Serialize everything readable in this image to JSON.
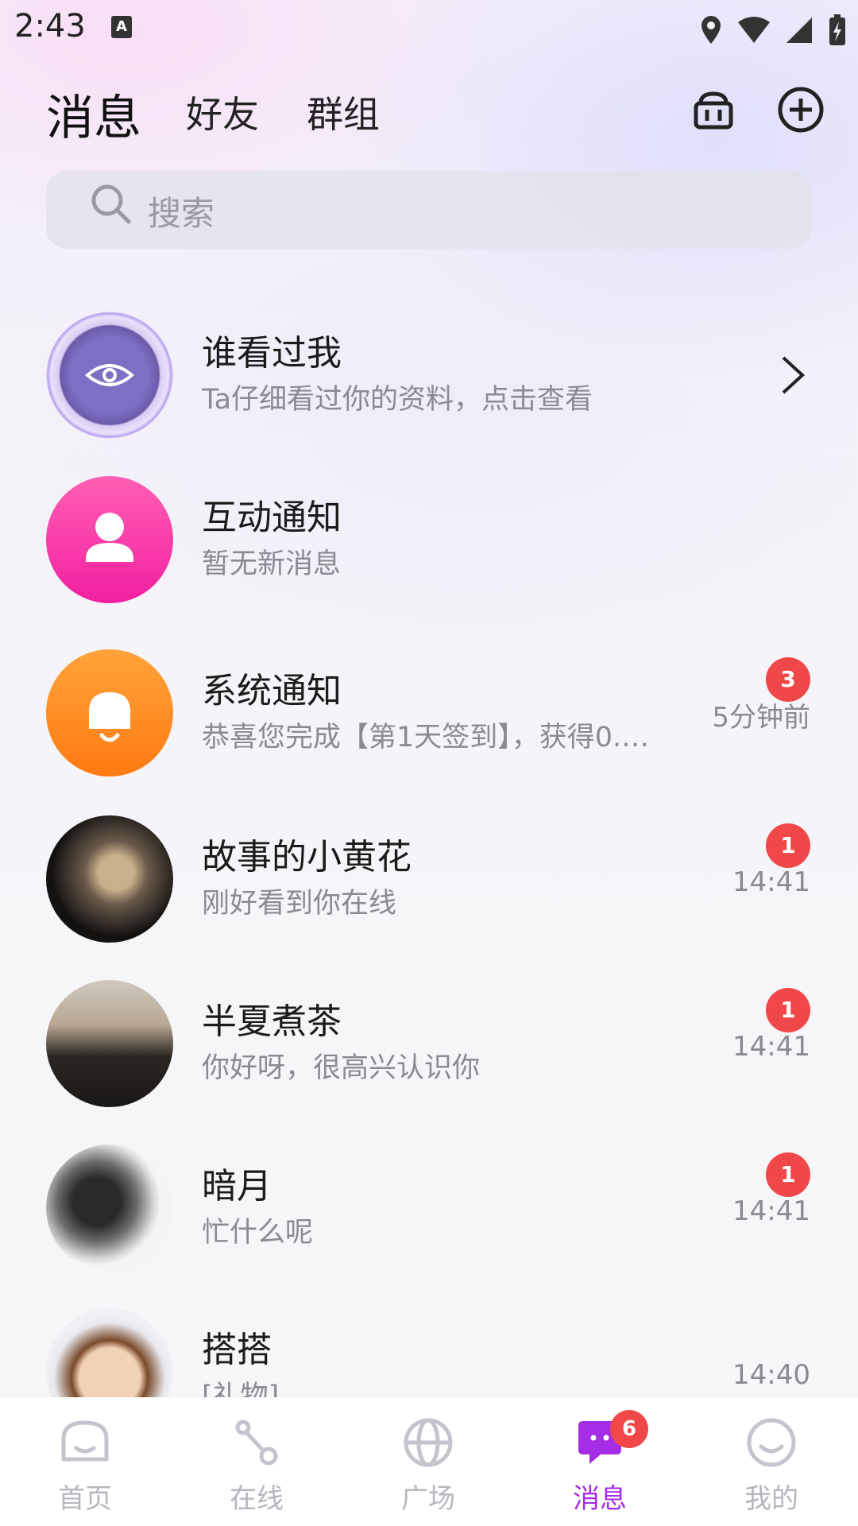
{
  "status_bar": {
    "time": "2:43",
    "a_icon": "A"
  },
  "header": {
    "tabs": [
      {
        "label": "消息",
        "active": true
      },
      {
        "label": "好友",
        "active": false
      },
      {
        "label": "群组",
        "active": false
      }
    ],
    "icons": [
      "basket-icon",
      "add-circle-icon"
    ]
  },
  "search": {
    "placeholder": "搜索"
  },
  "rows": [
    {
      "title": "谁看过我",
      "subtitle": "Ta仔细看过你的资料，点击查看",
      "icon": "eye-icon"
    },
    {
      "title": "互动通知",
      "subtitle": "暂无新消息",
      "icon": "user-icon",
      "color": "#f21fa0"
    },
    {
      "title": "系统通知",
      "subtitle": "恭喜您完成【第1天签到】，获得0.…",
      "badge": "3",
      "time": "5分钟前",
      "icon": "bell-icon",
      "color": "#ff8a1a"
    },
    {
      "title": "故事的小黄花",
      "subtitle": "刚好看到你在线",
      "badge": "1",
      "time": "14:41"
    },
    {
      "title": "半夏煮茶",
      "subtitle": "你好呀，很高兴认识你",
      "badge": "1",
      "time": "14:41"
    },
    {
      "title": "暗月",
      "subtitle": "忙什么呢",
      "badge": "1",
      "time": "14:41"
    },
    {
      "title": "搭搭",
      "subtitle": "[礼物]",
      "time": "14:40"
    }
  ],
  "nav": {
    "items": [
      {
        "label": "首页",
        "icon": "home-icon"
      },
      {
        "label": "在线",
        "icon": "online-icon"
      },
      {
        "label": "广场",
        "icon": "globe-icon"
      },
      {
        "label": "消息",
        "icon": "message-icon",
        "active": true,
        "badge": "6"
      },
      {
        "label": "我的",
        "icon": "profile-icon"
      }
    ]
  },
  "colors": {
    "accent": "#a52de6",
    "badge": "#f04848"
  }
}
